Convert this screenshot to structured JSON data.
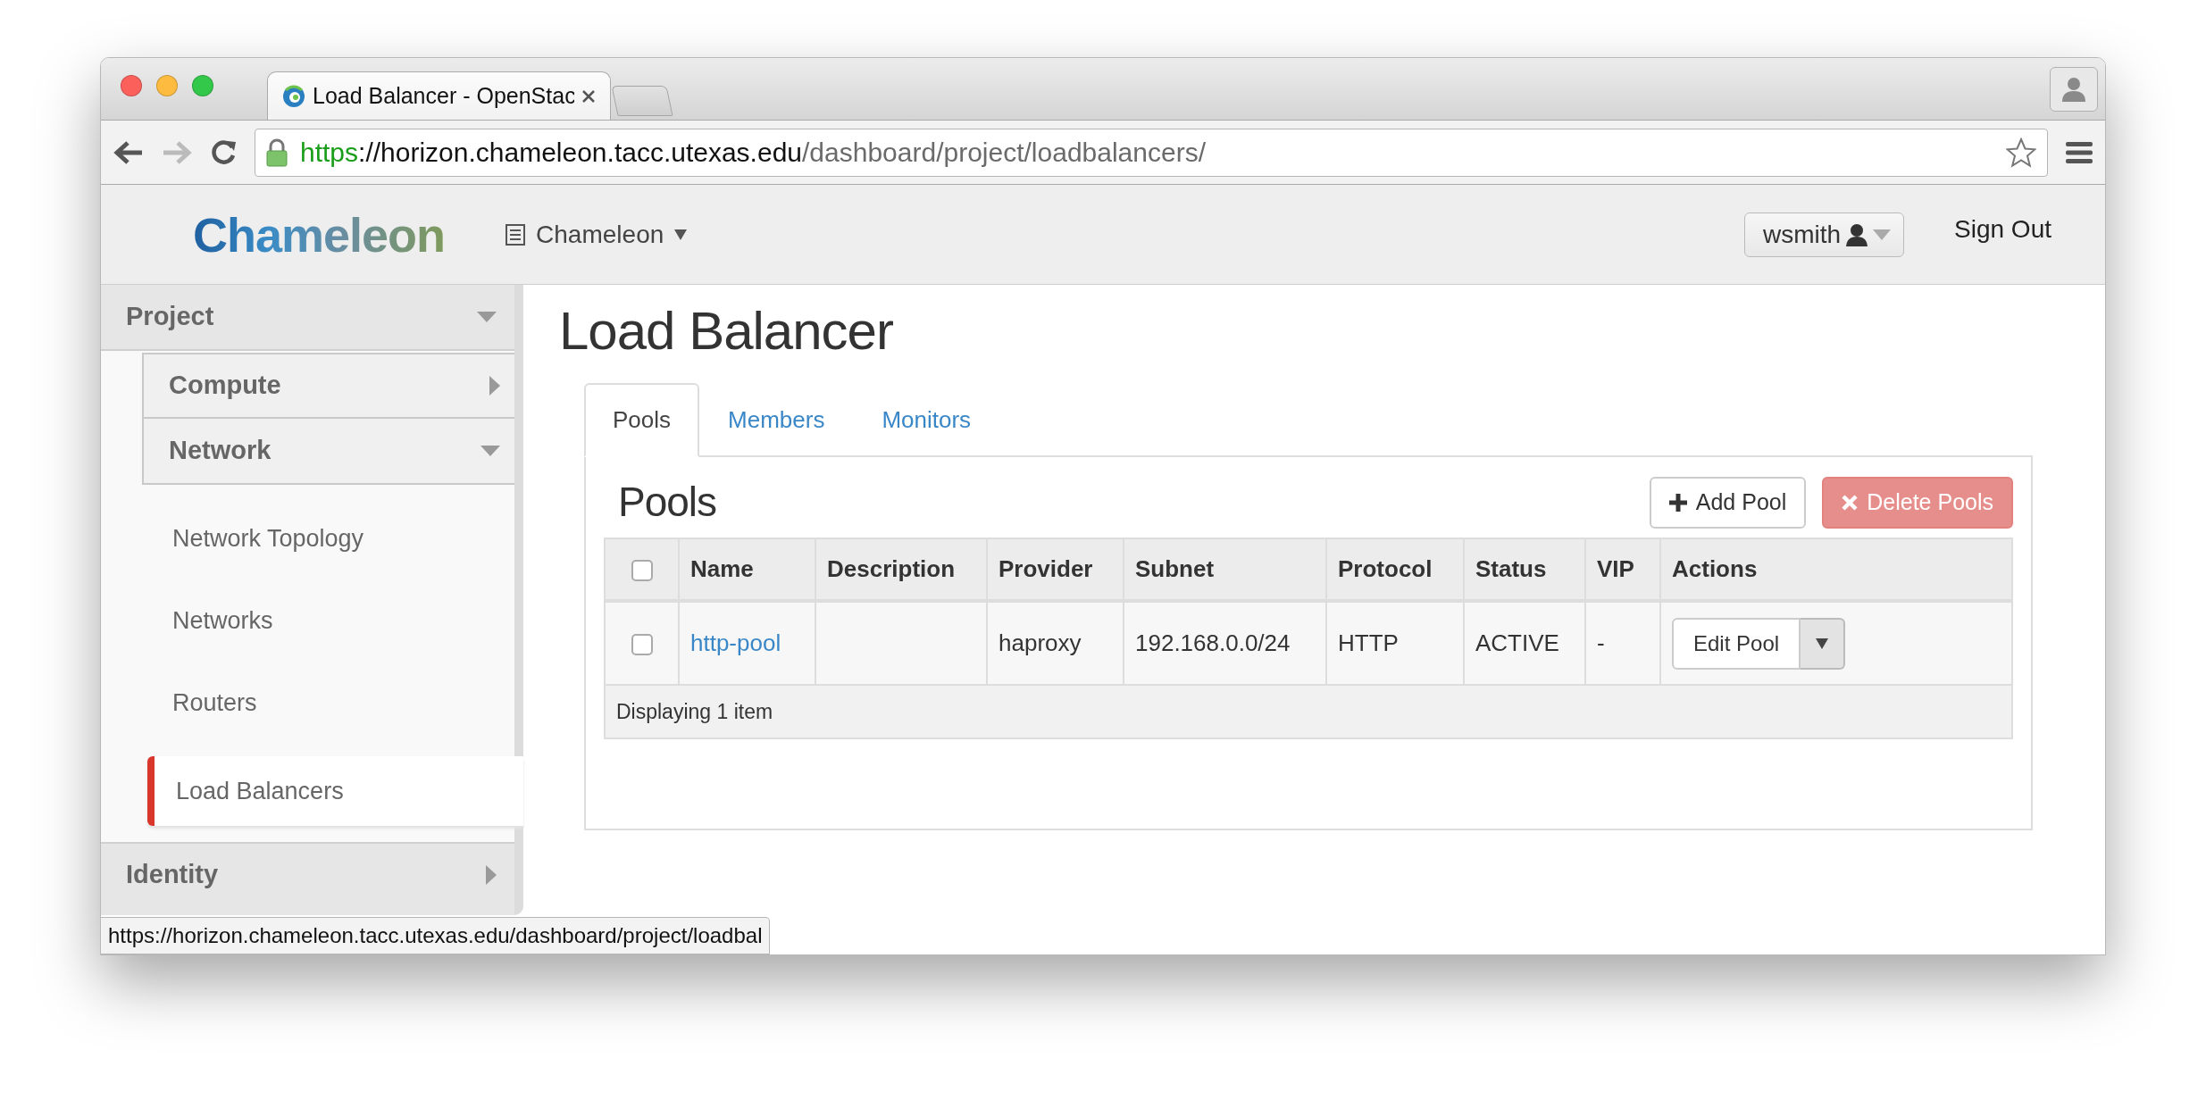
{
  "browser": {
    "tab_title": "Load Balancer - OpenStac",
    "back_disabled": false,
    "forward_disabled": true,
    "url_scheme": "https",
    "url_host": "://horizon.chameleon.tacc.utexas.edu",
    "url_path": "/dashboard/project/loadbalancers/"
  },
  "header": {
    "logo_text": "Chameleon",
    "project_menu": "Chameleon",
    "user_menu": "wsmith",
    "sign_out": "Sign Out"
  },
  "sidebar": [
    {
      "label": "Project",
      "expanded": true,
      "children": [
        {
          "label": "Compute",
          "expanded": false
        },
        {
          "label": "Network",
          "expanded": true,
          "children": [
            {
              "label": "Network Topology",
              "selected": false
            },
            {
              "label": "Networks",
              "selected": false
            },
            {
              "label": "Routers",
              "selected": false
            },
            {
              "label": "Load Balancers",
              "selected": true
            }
          ]
        }
      ]
    },
    {
      "label": "Identity",
      "expanded": false
    }
  ],
  "page_title": "Load Balancer",
  "tabs": [
    {
      "label": "Pools",
      "selected": true
    },
    {
      "label": "Members",
      "selected": false
    },
    {
      "label": "Monitors",
      "selected": false
    }
  ],
  "panel": {
    "title": "Pools",
    "actions": [
      {
        "label": "Add Pool",
        "kind": "add",
        "disabled": false
      },
      {
        "label": "Delete Pools",
        "kind": "delete",
        "disabled": true
      }
    ],
    "table": {
      "select_all_checked": false,
      "columns": [
        "Name",
        "Description",
        "Provider",
        "Subnet",
        "Protocol",
        "Status",
        "VIP",
        "Actions"
      ],
      "rows": [
        {
          "checked": false,
          "name": "http-pool",
          "provider": "haproxy",
          "subnet": "192.168.0.0/24",
          "protocol": "HTTP",
          "status": "ACTIVE",
          "vip": "-",
          "action": "Edit Pool"
        }
      ],
      "footer": "Displaying 1 item"
    }
  },
  "status_url": "https://horizon.chameleon.tacc.utexas.edu/dashboard/project/loadbal"
}
